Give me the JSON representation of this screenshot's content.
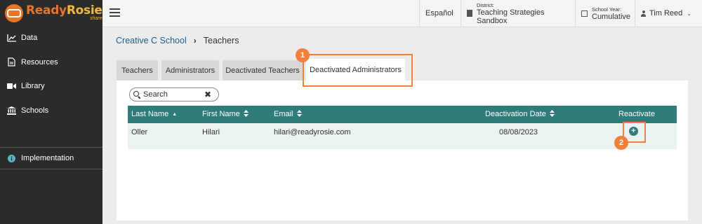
{
  "brand": {
    "name_part1": "Ready",
    "name_part2": "Rosie",
    "subtext": "share"
  },
  "sidebar": {
    "items": [
      {
        "label": "Data",
        "icon": "chart-line-icon"
      },
      {
        "label": "Resources",
        "icon": "document-icon"
      },
      {
        "label": "Library",
        "icon": "video-camera-icon"
      },
      {
        "label": "Schools",
        "icon": "building-columns-icon"
      }
    ],
    "implementation": {
      "label": "Implementation",
      "icon": "info-circle-icon"
    }
  },
  "topbar": {
    "language": "Español",
    "district_label": "District:",
    "district_value": "Teaching Strategies Sandbox",
    "year_label": "School Year:",
    "year_value": "Cumulative",
    "user_name": "Tim Reed"
  },
  "breadcrumb": {
    "school": "Creative C School",
    "separator": "›",
    "current": "Teachers"
  },
  "tabs": [
    {
      "label": "Teachers"
    },
    {
      "label": "Administrators"
    },
    {
      "label": "Deactivated Teachers"
    },
    {
      "label": "Deactivated Administrators",
      "active": true
    }
  ],
  "search": {
    "placeholder": "Search",
    "clear": "✖"
  },
  "table": {
    "columns": [
      {
        "label": "Last Name",
        "sort": "▲"
      },
      {
        "label": "First Name",
        "sort": "▲▼"
      },
      {
        "label": "Email",
        "sort": "▲▼"
      },
      {
        "label": "Deactivation Date",
        "sort": "▲▼"
      },
      {
        "label": "Reactivate",
        "sort": ""
      }
    ],
    "rows": [
      {
        "last_name": "Oller",
        "first_name": "Hilari",
        "email": "hilari@readyrosie.com",
        "deactivation_date": "08/08/2023",
        "reactivate": "+"
      }
    ]
  },
  "callouts": {
    "step1": "1",
    "step2": "2",
    "color": "#f0803c"
  },
  "colors": {
    "accent_teal": "#2e7d7a",
    "brand_orange": "#e8742a",
    "brand_yellow": "#f1b93a",
    "sidebar_bg": "#2b2b2b"
  }
}
